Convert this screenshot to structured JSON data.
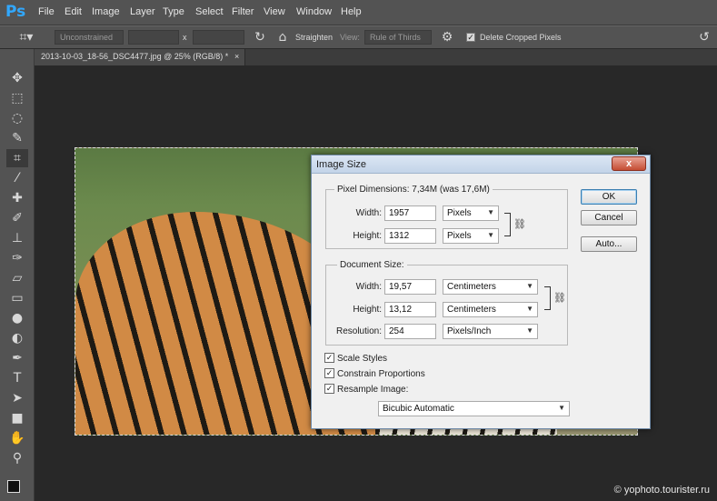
{
  "app": {
    "logo": "Ps",
    "menu": [
      "File",
      "Edit",
      "Image",
      "Layer",
      "Type",
      "Select",
      "Filter",
      "View",
      "Window",
      "Help"
    ]
  },
  "options_bar": {
    "crop_icon": "crop-icon",
    "ratio_preset": "Unconstrained",
    "width_value": "",
    "separator": "x",
    "height_value": "",
    "straighten_label": "Straighten",
    "view_label": "View:",
    "view_preset": "Rule of Thirds",
    "delete_cropped_label": "Delete Cropped Pixels",
    "delete_cropped_checked": true
  },
  "document_tab": {
    "title": "2013-10-03_18-56_DSC4477.jpg @ 25% (RGB/8) *",
    "close": "×"
  },
  "tools": [
    "move-icon",
    "marquee-icon",
    "lasso-icon",
    "quick-select-icon",
    "crop-icon",
    "eyedropper-icon",
    "healing-brush-icon",
    "brush-icon",
    "clone-stamp-icon",
    "history-brush-icon",
    "eraser-icon",
    "gradient-icon",
    "blur-icon",
    "dodge-icon",
    "pen-icon",
    "type-icon",
    "path-select-icon",
    "rectangle-icon",
    "hand-icon",
    "zoom-icon"
  ],
  "dialog": {
    "title": "Image Size",
    "close": "x",
    "pixel_dimensions": {
      "title": "Pixel Dimensions:",
      "size": "7,34M (was 17,6M)",
      "width_label": "Width:",
      "width_value": "1957",
      "width_unit": "Pixels",
      "height_label": "Height:",
      "height_value": "1312",
      "height_unit": "Pixels"
    },
    "document_size": {
      "title": "Document Size:",
      "width_label": "Width:",
      "width_value": "19,57",
      "width_unit": "Centimeters",
      "height_label": "Height:",
      "height_value": "13,12",
      "height_unit": "Centimeters",
      "resolution_label": "Resolution:",
      "resolution_value": "254",
      "resolution_unit": "Pixels/Inch"
    },
    "checkboxes": [
      {
        "label": "Scale Styles",
        "checked": true
      },
      {
        "label": "Constrain Proportions",
        "checked": true
      },
      {
        "label": "Resample Image:",
        "checked": true
      }
    ],
    "resample_method": "Bicubic Automatic",
    "buttons": {
      "ok": "OK",
      "cancel": "Cancel",
      "auto": "Auto..."
    }
  },
  "watermark": "© yophoto.tourister.ru"
}
